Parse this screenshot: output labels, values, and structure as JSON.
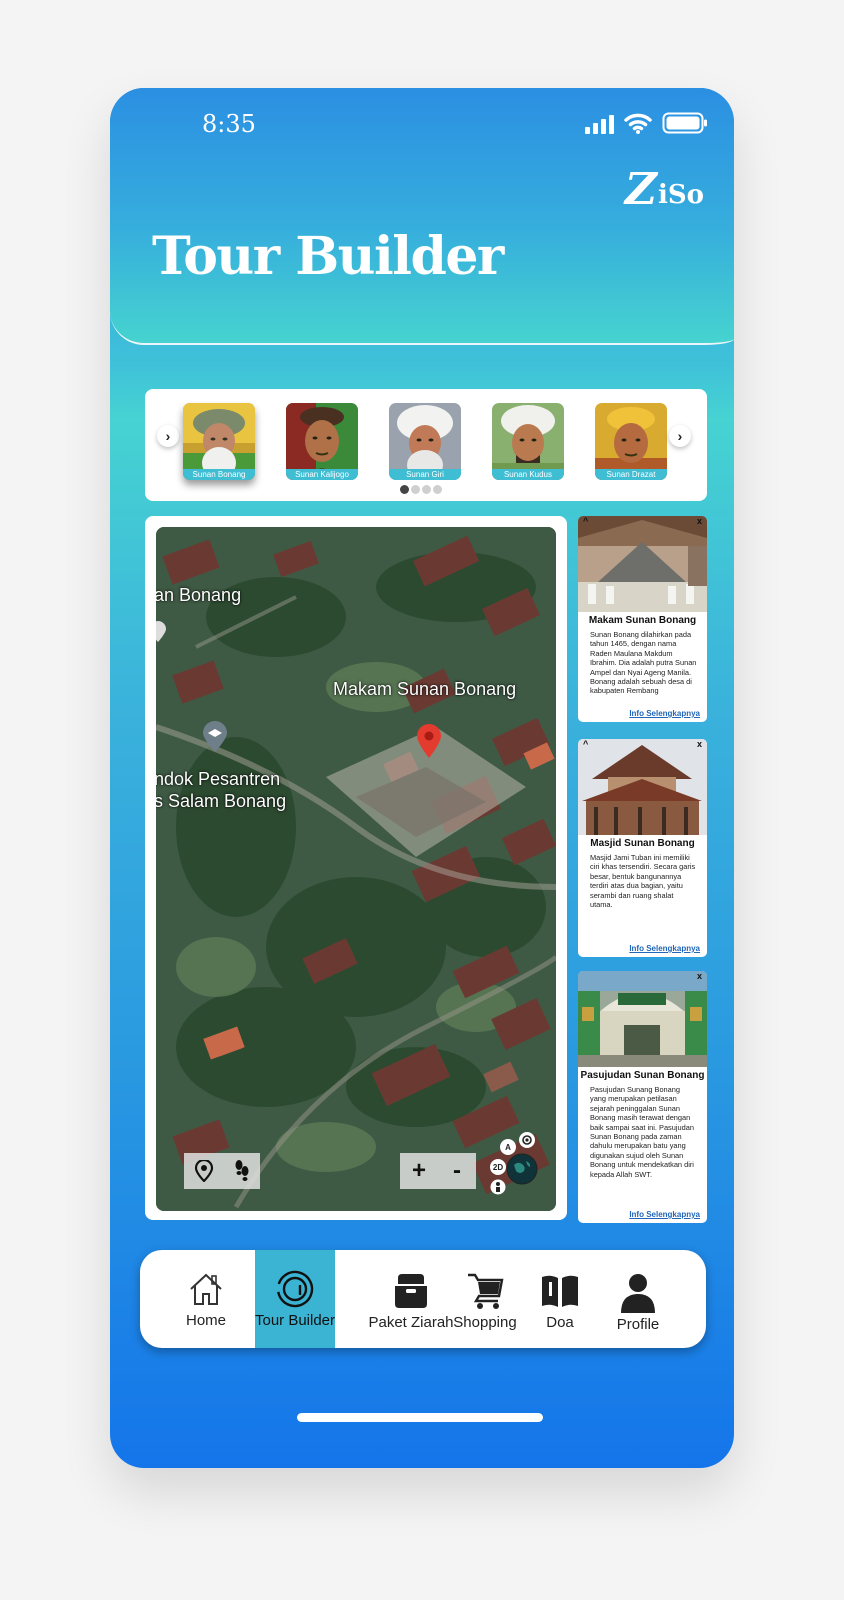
{
  "status_bar": {
    "time": "8:35"
  },
  "brand": {
    "logo_initial": "Z",
    "logo_rest": "iSo"
  },
  "header": {
    "title": "Tour Builder"
  },
  "carousel": {
    "items": [
      {
        "label": "Sunan Bonang",
        "active": true
      },
      {
        "label": "Sunan Kalijogo",
        "active": false
      },
      {
        "label": "Sunan Giri",
        "active": false
      },
      {
        "label": "Sunan Kudus",
        "active": false
      },
      {
        "label": "Sunan Drazat",
        "active": false
      }
    ],
    "prev_icon": "chevron-left-icon",
    "next_icon": "chevron-right-icon",
    "page_indicator": {
      "count": 4,
      "current": 1
    }
  },
  "map": {
    "labels": [
      "an Bonang",
      "Makam Sunan Bonang",
      "ndok Pesantren",
      "s Salam Bonang"
    ],
    "zoom_in": "+",
    "zoom_out": "-",
    "btn_a": "A",
    "btn_2d": "2D"
  },
  "info_cards": [
    {
      "title": "Makam Sunan Bonang",
      "body": "Sunan Bonang dilahirkan pada tahun 1465, dengan nama Raden Maulana Makdum Ibrahim. Dia adalah putra Sunan Ampel dan Nyai Ageng Manila. Bonang adalah sebuah desa di kabupaten Rembang",
      "link": "Info Selengkapnya"
    },
    {
      "title": "Masjid Sunan Bonang",
      "body": "Masjid Jami Tuban ini memiliki ciri khas tersendiri. Secara garis besar, bentuk bangunannya terdiri atas dua bagian, yaitu serambi dan ruang shalat utama.",
      "link": "Info Selengkapnya"
    },
    {
      "title": "Pasujudan Sunan Bonang",
      "body": "Pasujudan Sunang Bonang yang merupakan petilasan sejarah peninggalan Sunan Bonang masih terawat dengan baik sampai saat ini. Pasujudan Sunan Bonang pada zaman dahulu merupakan batu yang digunakan sujud oleh Sunan Bonang untuk mendekatkan diri kepada Allah SWT.",
      "link": "Info Selengkapnya"
    }
  ],
  "card_controls": {
    "collapse": "^",
    "close": "x"
  },
  "tabbar": {
    "items": [
      {
        "label": "Home",
        "icon": "home-icon"
      },
      {
        "label": "Tour Builder",
        "icon": "tour-builder-icon"
      },
      {
        "label": "Paket Ziarah",
        "icon": "package-icon"
      },
      {
        "label": "Shopping",
        "icon": "cart-icon"
      },
      {
        "label": "Doa",
        "icon": "book-icon"
      },
      {
        "label": "Profile",
        "icon": "user-icon"
      }
    ],
    "active": "Tour Builder"
  },
  "colors": {
    "accent": "#3bb4d4",
    "gradient_top": "#2a8fe3",
    "gradient_bottom": "#1475ea",
    "link": "#2166b8"
  }
}
